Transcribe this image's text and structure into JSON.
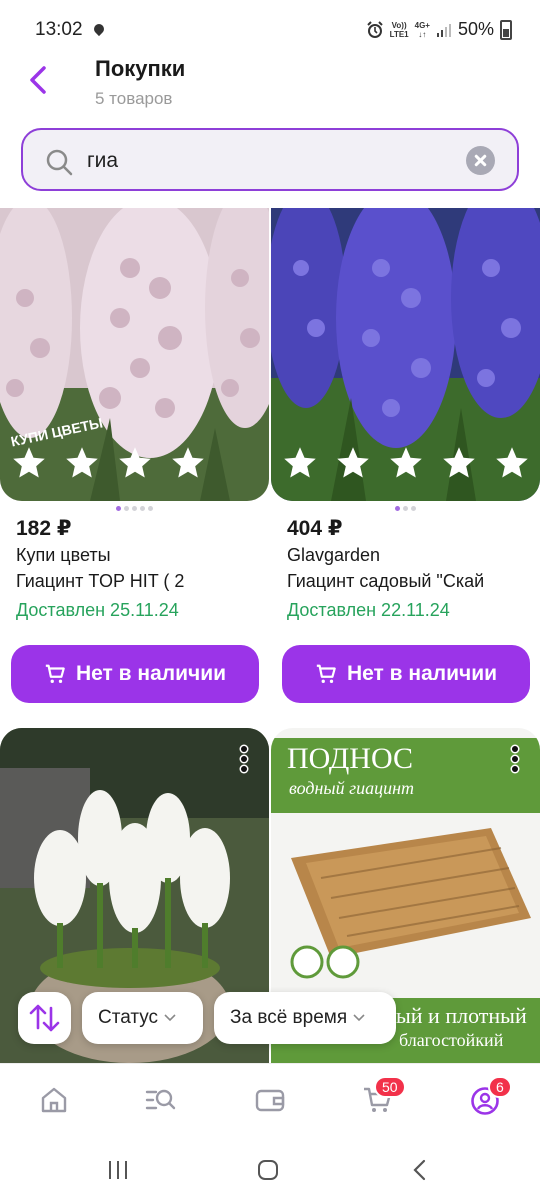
{
  "status_bar": {
    "time": "13:02",
    "network_top": "Vo))",
    "network_bottom": "LTE1",
    "network2_top": "4G+",
    "battery": "50%"
  },
  "header": {
    "title": "Покупки",
    "subtitle": "5 товаров"
  },
  "search": {
    "value": "гиа",
    "placeholder": ""
  },
  "products": [
    {
      "price": "182 ₽",
      "seller": "Купи цветы",
      "name": "Гиацинт TOP HIT ( 2",
      "delivery": "Доставлен 25.11.24",
      "button": "Нет в наличии",
      "image_watermark": "КУПИ ЦВЕТЫ",
      "rating": 0
    },
    {
      "price": "404 ₽",
      "seller": "Glavgarden",
      "name": "Гиацинт садовый \"Скай",
      "delivery": "Доставлен 22.11.24",
      "button": "Нет в наличии",
      "rating": 0
    },
    {
      "image_text": ""
    },
    {
      "image_title": "ПОДНОС",
      "image_subtitle": "водный гиацинт",
      "image_bottom_text": "ый и плотный",
      "image_bottom_text2": "благостойкий"
    }
  ],
  "filters": {
    "status_label": "Статус",
    "period_label": "За всё время"
  },
  "tab_bar": {
    "cart_badge": "50",
    "profile_badge": "6"
  },
  "colors": {
    "accent": "#9b34e8",
    "search_border": "#8e3fd8",
    "delivered": "#27a35c",
    "badge": "#f2314a"
  }
}
